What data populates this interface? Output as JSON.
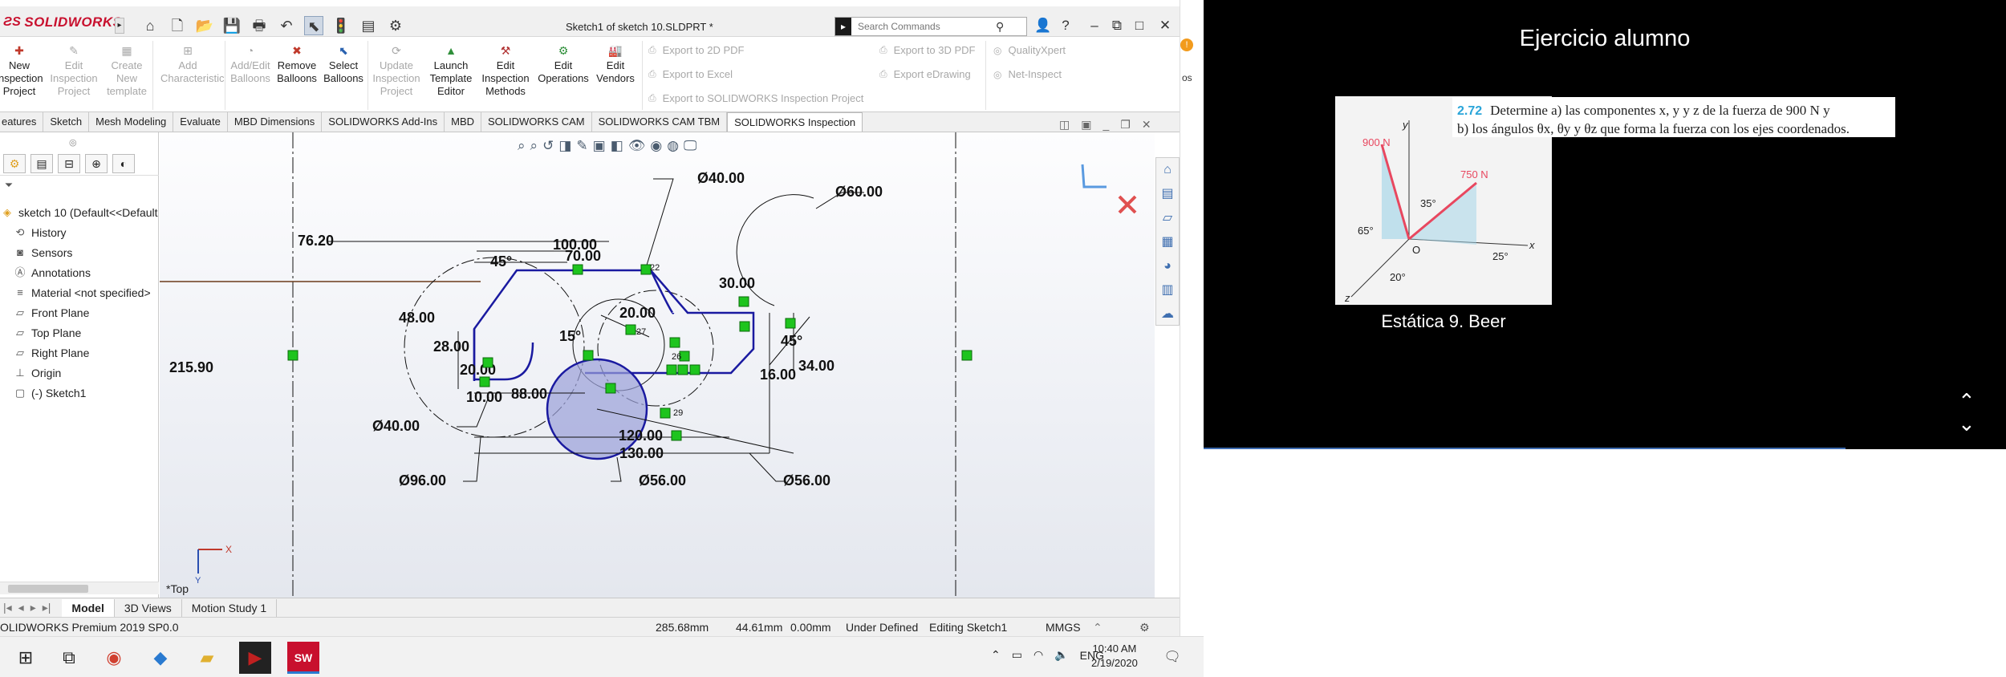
{
  "app": {
    "logo": "SOLIDWORKS",
    "document_title": "Sketch1 of sketch 10.SLDPRT *",
    "search_placeholder": "Search Commands"
  },
  "ribbon": {
    "buttons": [
      {
        "label": "New Inspection Project",
        "enabled": true
      },
      {
        "label": "Edit Inspection Project",
        "enabled": false
      },
      {
        "label": "Create New template",
        "enabled": false
      },
      {
        "label": "Add Characteristic",
        "enabled": false
      },
      {
        "label": "Add/Edit Balloons",
        "enabled": false
      },
      {
        "label": "Remove Balloons",
        "enabled": true
      },
      {
        "label": "Select Balloons",
        "enabled": true
      },
      {
        "label": "Update Inspection Project",
        "enabled": false
      },
      {
        "label": "Launch Template Editor",
        "enabled": true
      },
      {
        "label": "Edit Inspection Methods",
        "enabled": true
      },
      {
        "label": "Edit Operations",
        "enabled": true
      },
      {
        "label": "Edit Vendors",
        "enabled": true
      }
    ],
    "export_links": [
      "Export to 2D PDF",
      "Export to Excel",
      "Export to SOLIDWORKS Inspection Project",
      "Export to 3D PDF",
      "Export eDrawing",
      "QualityXpert",
      "Net-Inspect"
    ]
  },
  "tabs": [
    "eatures",
    "Sketch",
    "Mesh Modeling",
    "Evaluate",
    "MBD Dimensions",
    "SOLIDWORKS Add-Ins",
    "MBD",
    "SOLIDWORKS CAM",
    "SOLIDWORKS CAM TBM",
    "SOLIDWORKS Inspection"
  ],
  "feature_tree": {
    "root": "sketch 10  (Default<<Default",
    "items": [
      "History",
      "Sensors",
      "Annotations",
      "Material <not specified>",
      "Front Plane",
      "Top Plane",
      "Right Plane",
      "Origin",
      "(-) Sketch1"
    ]
  },
  "sketch": {
    "dims": {
      "d40_top": "Ø40.00",
      "d60": "Ø60.00",
      "v76": "76.20",
      "v100": "100.00",
      "v70": "70.00",
      "a45a": "45°",
      "v30": "30.00",
      "v48": "48.00",
      "v20a": "20.00",
      "v28": "28.00",
      "a15": "15°",
      "a45b": "45°",
      "v34": "34.00",
      "v16": "16.00",
      "v215": "215.90",
      "v20b": "20.00",
      "v10": "10.00",
      "v88": "88.00",
      "d40_left": "Ø40.00",
      "v120": "120.00",
      "v130": "130.00",
      "d96": "Ø96.00",
      "d56a": "Ø56.00",
      "d56b": "Ø56.00"
    },
    "relation_labels": [
      "22",
      "27",
      "26",
      "29"
    ],
    "view_label": "*Top",
    "axis_x": "X",
    "axis_y": "Y"
  },
  "bottom_tabs": [
    "Model",
    "3D Views",
    "Motion Study 1"
  ],
  "status": {
    "product": "OLIDWORKS Premium 2019 SP0.0",
    "x": "285.68mm",
    "y": "44.61mm",
    "z": "0.00mm",
    "state": "Under Defined",
    "mode": "Editing Sketch1",
    "units": "MMGS"
  },
  "taskbar": {
    "lang": "ENG",
    "time": "10:40 AM",
    "date": "2/19/2020"
  },
  "edge": {
    "os_label": "os"
  },
  "slide": {
    "title": "Ejercicio alumno",
    "problem_number": "2.72",
    "problem_line1": "Determine a) las componentes x, y y z de la fuerza de 900 N y",
    "problem_line2": "b) los ángulos θx, θy y θz que forma la fuerza con los ejes coordenados.",
    "caption": "Estática 9. Beer",
    "figure": {
      "f1": "900 N",
      "f2": "750 N",
      "a35": "35°",
      "a65": "65°",
      "a25": "25°",
      "a20": "20°",
      "o": "O",
      "x": "x",
      "y": "y",
      "z": "z"
    }
  },
  "colors": {
    "sketch_blue": "#1a1aa0",
    "relation_green": "#1ec41e",
    "slide_bg": "#000000",
    "accent_blue": "#2aa5d9",
    "force_red": "#e8475f"
  }
}
